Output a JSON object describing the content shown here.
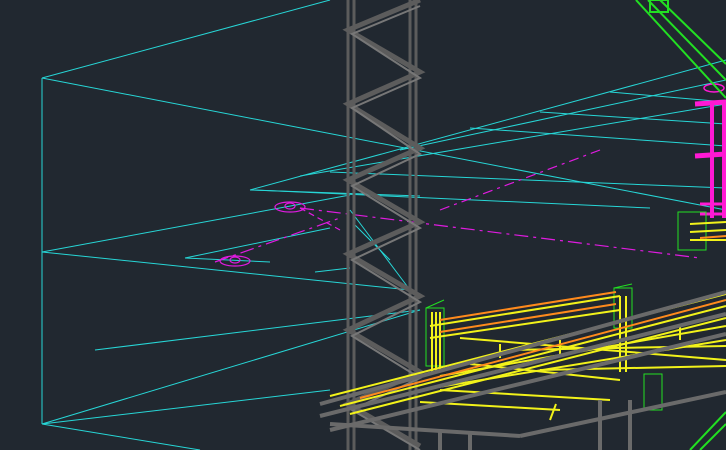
{
  "canvas": {
    "background": "#212830",
    "layer_colors": {
      "room_outline": "#27d6d6",
      "tower_truss": "#5c5c5c",
      "platform_frame": "#6a6a6a",
      "platform_deck": "#f2f21a",
      "platform_accent": "#ff8a1c",
      "centerline": "#e01be0",
      "crane": "#ff19d4",
      "fixture_boxes": "#1ed42a",
      "arm": "#22e022"
    }
  }
}
